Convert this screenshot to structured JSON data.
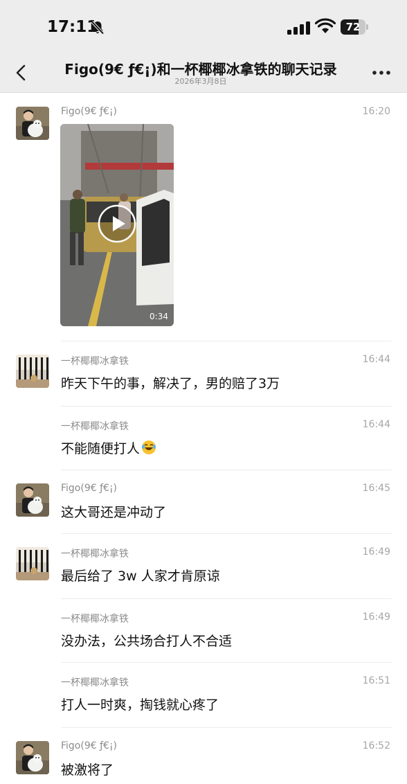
{
  "status_bar": {
    "time": "17:11",
    "battery": "72",
    "battery_level": 0.72
  },
  "header": {
    "title": "Figo(9€ ƒ€¡)和一杯椰椰冰拿铁的聊天记录",
    "subtitle": "2026年3月8日"
  },
  "video": {
    "duration": "0:34"
  },
  "messages": [
    {
      "sender": "Figo(9€ ƒ€¡)",
      "time": "16:20",
      "text": ""
    },
    {
      "sender": "一杯椰椰冰拿铁",
      "time": "16:44",
      "text": "昨天下午的事，解决了，男的赔了3万"
    },
    {
      "sender": "一杯椰椰冰拿铁",
      "time": "16:44",
      "text": "不能随便打人"
    },
    {
      "sender": "Figo(9€ ƒ€¡)",
      "time": "16:45",
      "text": "这大哥还是冲动了"
    },
    {
      "sender": "一杯椰椰冰拿铁",
      "time": "16:49",
      "text": "最后给了 3w 人家才肯原谅"
    },
    {
      "sender": "一杯椰椰冰拿铁",
      "time": "16:49",
      "text": "没办法，公共场合打人不合适"
    },
    {
      "sender": "一杯椰椰冰拿铁",
      "time": "16:51",
      "text": "打人一时爽，掏钱就心疼了"
    },
    {
      "sender": "Figo(9€ ƒ€¡)",
      "time": "16:52",
      "text": "被激将了"
    }
  ]
}
